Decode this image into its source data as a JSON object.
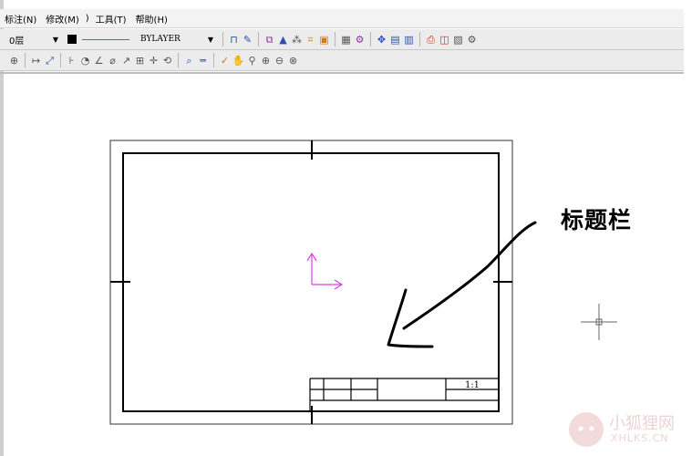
{
  "menu": {
    "items": [
      {
        "label": "标注(N)"
      },
      {
        "label": "修改(M)"
      },
      {
        "label": ")"
      },
      {
        "label": "工具(T)"
      },
      {
        "label": "帮助(H)"
      }
    ]
  },
  "toolbar": {
    "layer_value": "0层",
    "linetype_value": "BYLAYER",
    "row1_tools": [
      {
        "name": "polyline-icon",
        "glyph": "⊓",
        "color": "c-blue"
      },
      {
        "name": "pencil-icon",
        "glyph": "✎",
        "color": "c-blue"
      },
      {
        "name": "sep"
      },
      {
        "name": "layer-tool-icon",
        "glyph": "⧉",
        "color": "c-purple"
      },
      {
        "name": "triangle-icon",
        "glyph": "▲",
        "color": "c-blue"
      },
      {
        "name": "array-icon",
        "glyph": "⁂",
        "color": "c-gray"
      },
      {
        "name": "hatch-icon",
        "glyph": "⌗",
        "color": "c-orange"
      },
      {
        "name": "block-icon",
        "glyph": "▣",
        "color": "c-orange"
      },
      {
        "name": "sep"
      },
      {
        "name": "grid-icon",
        "glyph": "▦",
        "color": "c-gray"
      },
      {
        "name": "gear-icon",
        "glyph": "⚙",
        "color": "c-purple"
      },
      {
        "name": "sep"
      },
      {
        "name": "move-icon",
        "glyph": "✥",
        "color": "c-blue"
      },
      {
        "name": "table-icon",
        "glyph": "▤",
        "color": "c-blue"
      },
      {
        "name": "calendar-icon",
        "glyph": "▥",
        "color": "c-blue"
      },
      {
        "name": "sep"
      },
      {
        "name": "print-icon",
        "glyph": "⎙",
        "color": "c-red"
      },
      {
        "name": "book-icon",
        "glyph": "◫",
        "color": "c-red"
      },
      {
        "name": "chart-icon",
        "glyph": "▧",
        "color": "c-gray"
      },
      {
        "name": "settings-icon",
        "glyph": "⚙",
        "color": "c-gray"
      }
    ],
    "row2_tools": [
      {
        "name": "target-icon",
        "glyph": "⊕",
        "color": "c-gray"
      },
      {
        "name": "sep"
      },
      {
        "name": "dimension-linear-icon",
        "glyph": "↦",
        "color": "c-gray"
      },
      {
        "name": "dimension-aligned-icon",
        "glyph": "⤢",
        "color": "c-blue"
      },
      {
        "name": "sep"
      },
      {
        "name": "dimension-ordinate-icon",
        "glyph": "⊦",
        "color": "c-gray"
      },
      {
        "name": "dimension-radius-icon",
        "glyph": "◔",
        "color": "c-gray"
      },
      {
        "name": "dimension-angle-icon",
        "glyph": "∠",
        "color": "c-gray"
      },
      {
        "name": "dimension-diameter-icon",
        "glyph": "⌀",
        "color": "c-gray"
      },
      {
        "name": "leader-icon",
        "glyph": "↗",
        "color": "c-gray"
      },
      {
        "name": "tolerance-icon",
        "glyph": "⊞",
        "color": "c-gray"
      },
      {
        "name": "center-mark-icon",
        "glyph": "✛",
        "color": "c-gray"
      },
      {
        "name": "dimension-edit-icon",
        "glyph": "⟲",
        "color": "c-gray"
      },
      {
        "name": "sep"
      },
      {
        "name": "zoom-window-icon",
        "glyph": "⌕",
        "color": "c-blue"
      },
      {
        "name": "measure-icon",
        "glyph": "═",
        "color": "c-blue"
      },
      {
        "name": "sep"
      },
      {
        "name": "brush-icon",
        "glyph": "✓",
        "color": "c-orange"
      },
      {
        "name": "pan-icon",
        "glyph": "✋",
        "color": "c-gray"
      },
      {
        "name": "zoom-realtime-icon",
        "glyph": "⚲",
        "color": "c-gray"
      },
      {
        "name": "zoom-in-icon",
        "glyph": "⊕",
        "color": "c-gray"
      },
      {
        "name": "zoom-out-icon",
        "glyph": "⊖",
        "color": "c-gray"
      },
      {
        "name": "zoom-extents-icon",
        "glyph": "⊗",
        "color": "c-gray"
      }
    ]
  },
  "drawing": {
    "annotation": "标题栏",
    "scale_label": "1:1"
  },
  "watermark": {
    "title": "小狐狸网",
    "subtitle": "XHLKS.CN"
  }
}
